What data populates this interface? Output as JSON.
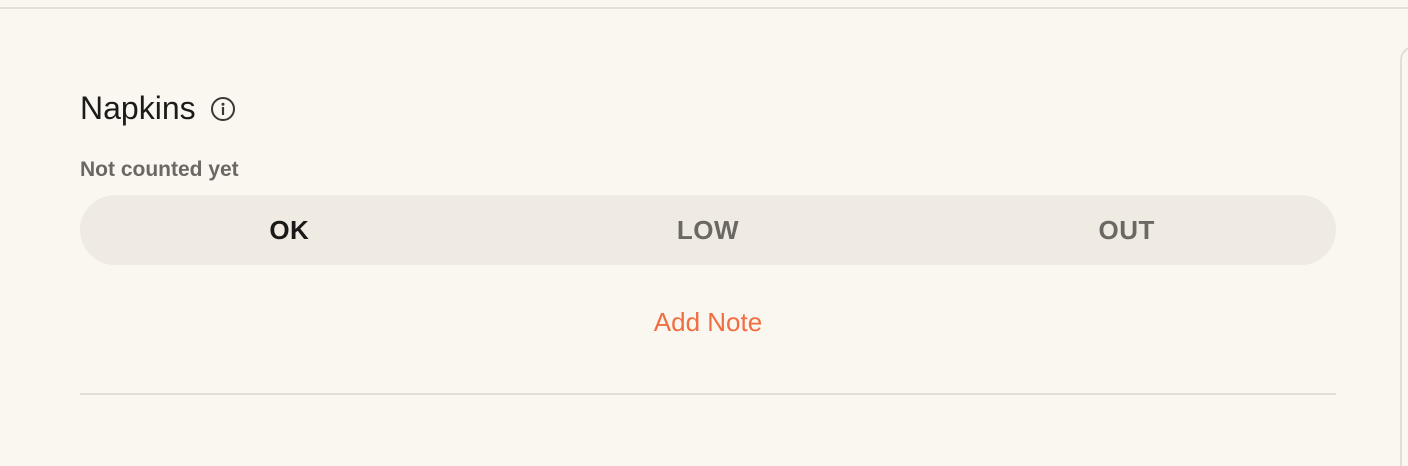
{
  "item": {
    "name": "Napkins",
    "info_icon": "info-circle-icon",
    "count_status": "Not counted yet"
  },
  "stock_levels": {
    "options": [
      "OK",
      "LOW",
      "OUT"
    ],
    "selected": "OK"
  },
  "actions": {
    "add_note_label": "Add Note"
  },
  "colors": {
    "background": "#faf7f1",
    "segment_bg": "#efebe2",
    "accent": "#f06e42",
    "text_primary": "#1a1917",
    "text_muted": "#6b6864"
  }
}
